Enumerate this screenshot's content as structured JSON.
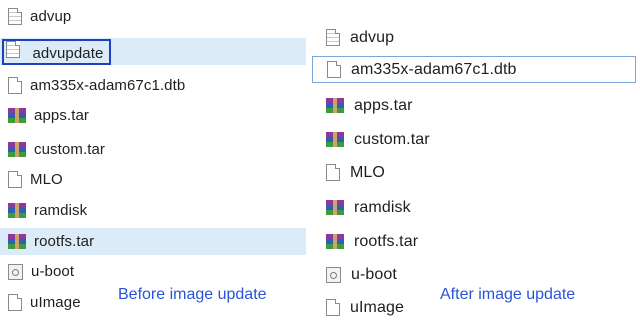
{
  "before": {
    "caption": "Before image update",
    "files": [
      {
        "name": "advup",
        "icon": "document-icon"
      },
      {
        "name": "advupdate",
        "icon": "document-icon",
        "selected": true
      },
      {
        "name": "am335x-adam67c1.dtb",
        "icon": "blank-file-icon"
      },
      {
        "name": "apps.tar",
        "icon": "archive-icon"
      },
      {
        "name": "custom.tar",
        "icon": "archive-icon"
      },
      {
        "name": "MLO",
        "icon": "blank-file-icon"
      },
      {
        "name": "ramdisk",
        "icon": "archive-icon"
      },
      {
        "name": "rootfs.tar",
        "icon": "archive-icon"
      },
      {
        "name": "u-boot",
        "icon": "system-file-icon"
      },
      {
        "name": "uImage",
        "icon": "blank-file-icon"
      }
    ]
  },
  "after": {
    "caption": "After image update",
    "files": [
      {
        "name": "advup",
        "icon": "document-icon"
      },
      {
        "name": "am335x-adam67c1.dtb",
        "icon": "blank-file-icon",
        "focused": true
      },
      {
        "name": "apps.tar",
        "icon": "archive-icon"
      },
      {
        "name": "custom.tar",
        "icon": "archive-icon"
      },
      {
        "name": "MLO",
        "icon": "blank-file-icon"
      },
      {
        "name": "ramdisk",
        "icon": "archive-icon"
      },
      {
        "name": "rootfs.tar",
        "icon": "archive-icon"
      },
      {
        "name": "u-boot",
        "icon": "system-file-icon"
      },
      {
        "name": "uImage",
        "icon": "blank-file-icon"
      }
    ]
  },
  "colors": {
    "selection_background": "#dcebf8",
    "selection_border": "#1f3fbf",
    "caption": "#2a54d8"
  }
}
